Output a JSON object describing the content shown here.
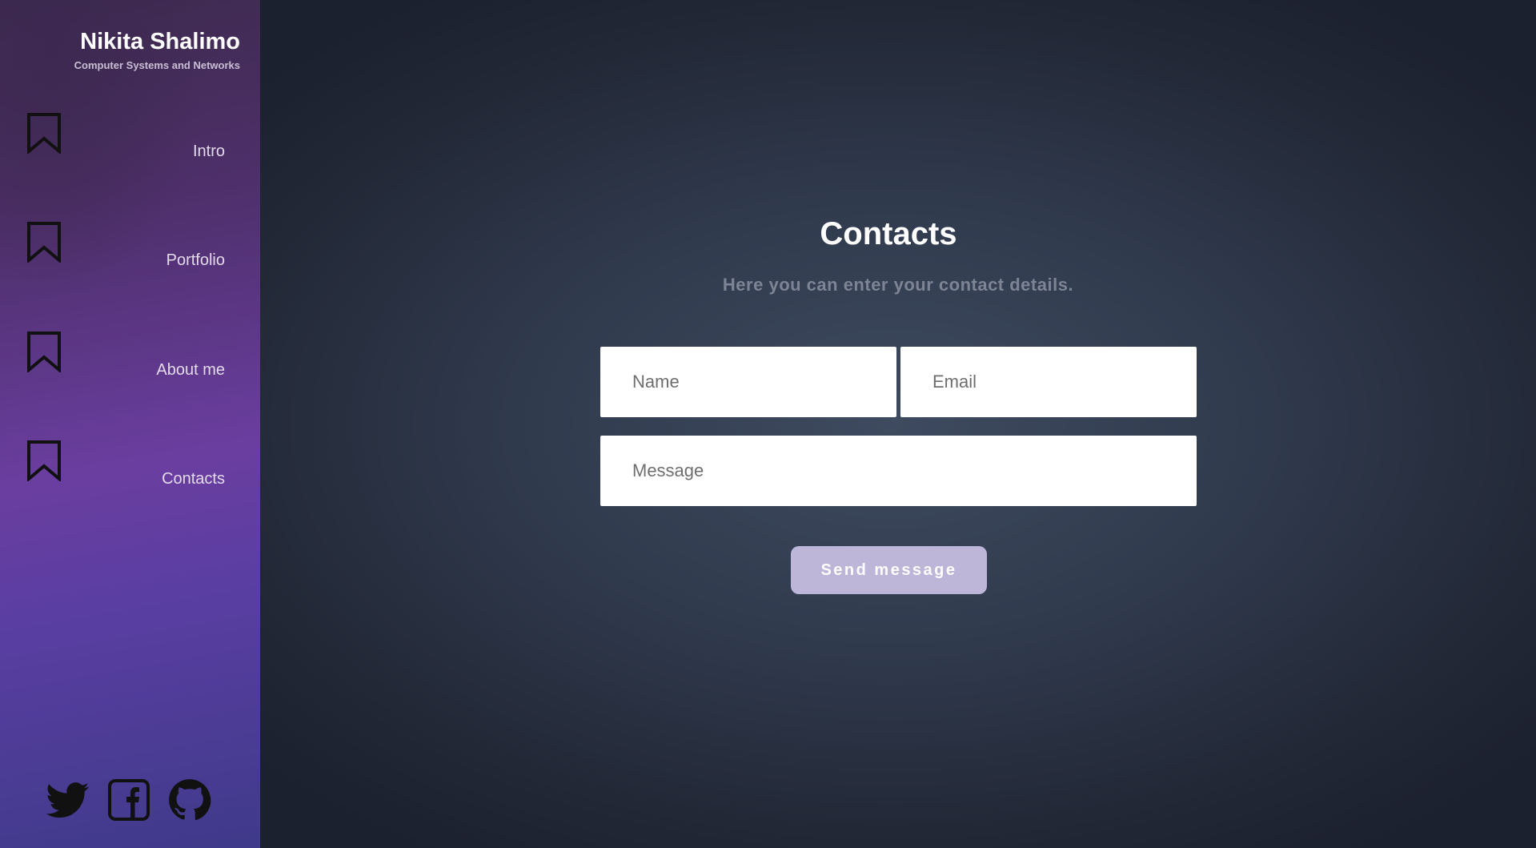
{
  "sidebar": {
    "brand": {
      "name": "Nikita Shalimo",
      "subtitle": "Computer Systems and Networks"
    },
    "nav": [
      {
        "label": "Intro",
        "icon": "bookmark-icon"
      },
      {
        "label": "Portfolio",
        "icon": "bookmark-icon"
      },
      {
        "label": "About me",
        "icon": "bookmark-icon"
      },
      {
        "label": "Contacts",
        "icon": "bookmark-icon"
      }
    ],
    "socials": [
      "twitter-icon",
      "facebook-icon",
      "github-icon"
    ]
  },
  "main": {
    "title": "Contacts",
    "subtitle": "Here you can enter your contact details.",
    "form": {
      "name_placeholder": "Name",
      "email_placeholder": "Email",
      "message_placeholder": "Message",
      "send_label": "Send message"
    }
  },
  "colors": {
    "accent_button": "#bdb6d9",
    "sidebar_purple": "#6a3ea0",
    "background_dark": "#222836"
  }
}
